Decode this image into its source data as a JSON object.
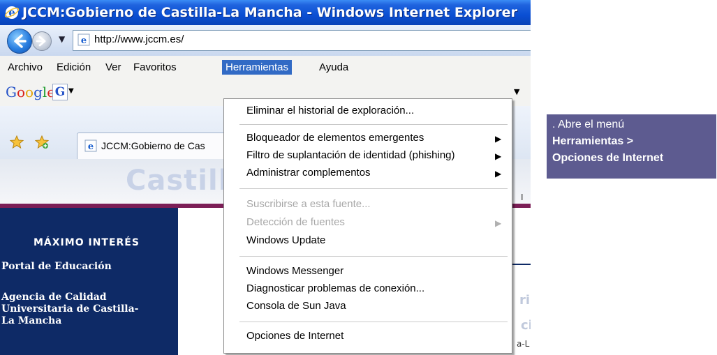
{
  "window": {
    "title": "JCCM:Gobierno de Castilla-La Mancha - Windows Internet Explorer"
  },
  "address": {
    "url": "http://www.jccm.es/"
  },
  "menubar": {
    "items": [
      "Archivo",
      "Edición",
      "Ver",
      "Favoritos",
      "Herramientas",
      "Ayuda"
    ],
    "active": "Herramientas"
  },
  "googlebar": {
    "logo": [
      "G",
      "o",
      "o",
      "g",
      "l",
      "e"
    ],
    "g_button": "G"
  },
  "tabs": [
    {
      "label": "JCCM:Gobierno de Cas"
    }
  ],
  "page": {
    "banner_text": "Castill",
    "banner_right_char": "I",
    "sidebar_heading": "MÁXIMO INTERÉS",
    "sidebar_links": [
      "Portal de Educación",
      "Agencia de Calidad\nUniversitaria de Castilla-\nLa Mancha"
    ],
    "faint_right_1": "ri",
    "faint_right_2": "ci",
    "faint_right_3": "a-L"
  },
  "tools_menu": {
    "items": [
      {
        "label": "Eliminar el historial de exploración...",
        "disabled": false,
        "submenu": false
      },
      {
        "label": "Bloqueador de elementos emergentes",
        "disabled": false,
        "submenu": true
      },
      {
        "label": "Filtro de suplantación de identidad (phishing)",
        "disabled": false,
        "submenu": true
      },
      {
        "label": "Administrar complementos",
        "disabled": false,
        "submenu": true
      },
      {
        "label": "Suscribirse a esta fuente...",
        "disabled": true,
        "submenu": false
      },
      {
        "label": "Detección de fuentes",
        "disabled": true,
        "submenu": true
      },
      {
        "label": "Windows Update",
        "disabled": false,
        "submenu": false
      },
      {
        "label": "Windows Messenger",
        "disabled": false,
        "submenu": false
      },
      {
        "label": "Diagnosticar problemas de conexión...",
        "disabled": false,
        "submenu": false
      },
      {
        "label": "Consola de Sun Java",
        "disabled": false,
        "submenu": false
      },
      {
        "label": "Opciones de Internet",
        "disabled": false,
        "submenu": false
      }
    ]
  },
  "callout": {
    "line1": ". Abre el menú",
    "line2": "Herramientas >",
    "line3": "Opciones de Internet"
  },
  "colors": {
    "titlebar": "#0a4fd3",
    "menu_highlight": "#316ac5",
    "sidebar": "#0e2a66",
    "callout": "#5d5b90",
    "banner_strip": "#7b1e56"
  }
}
